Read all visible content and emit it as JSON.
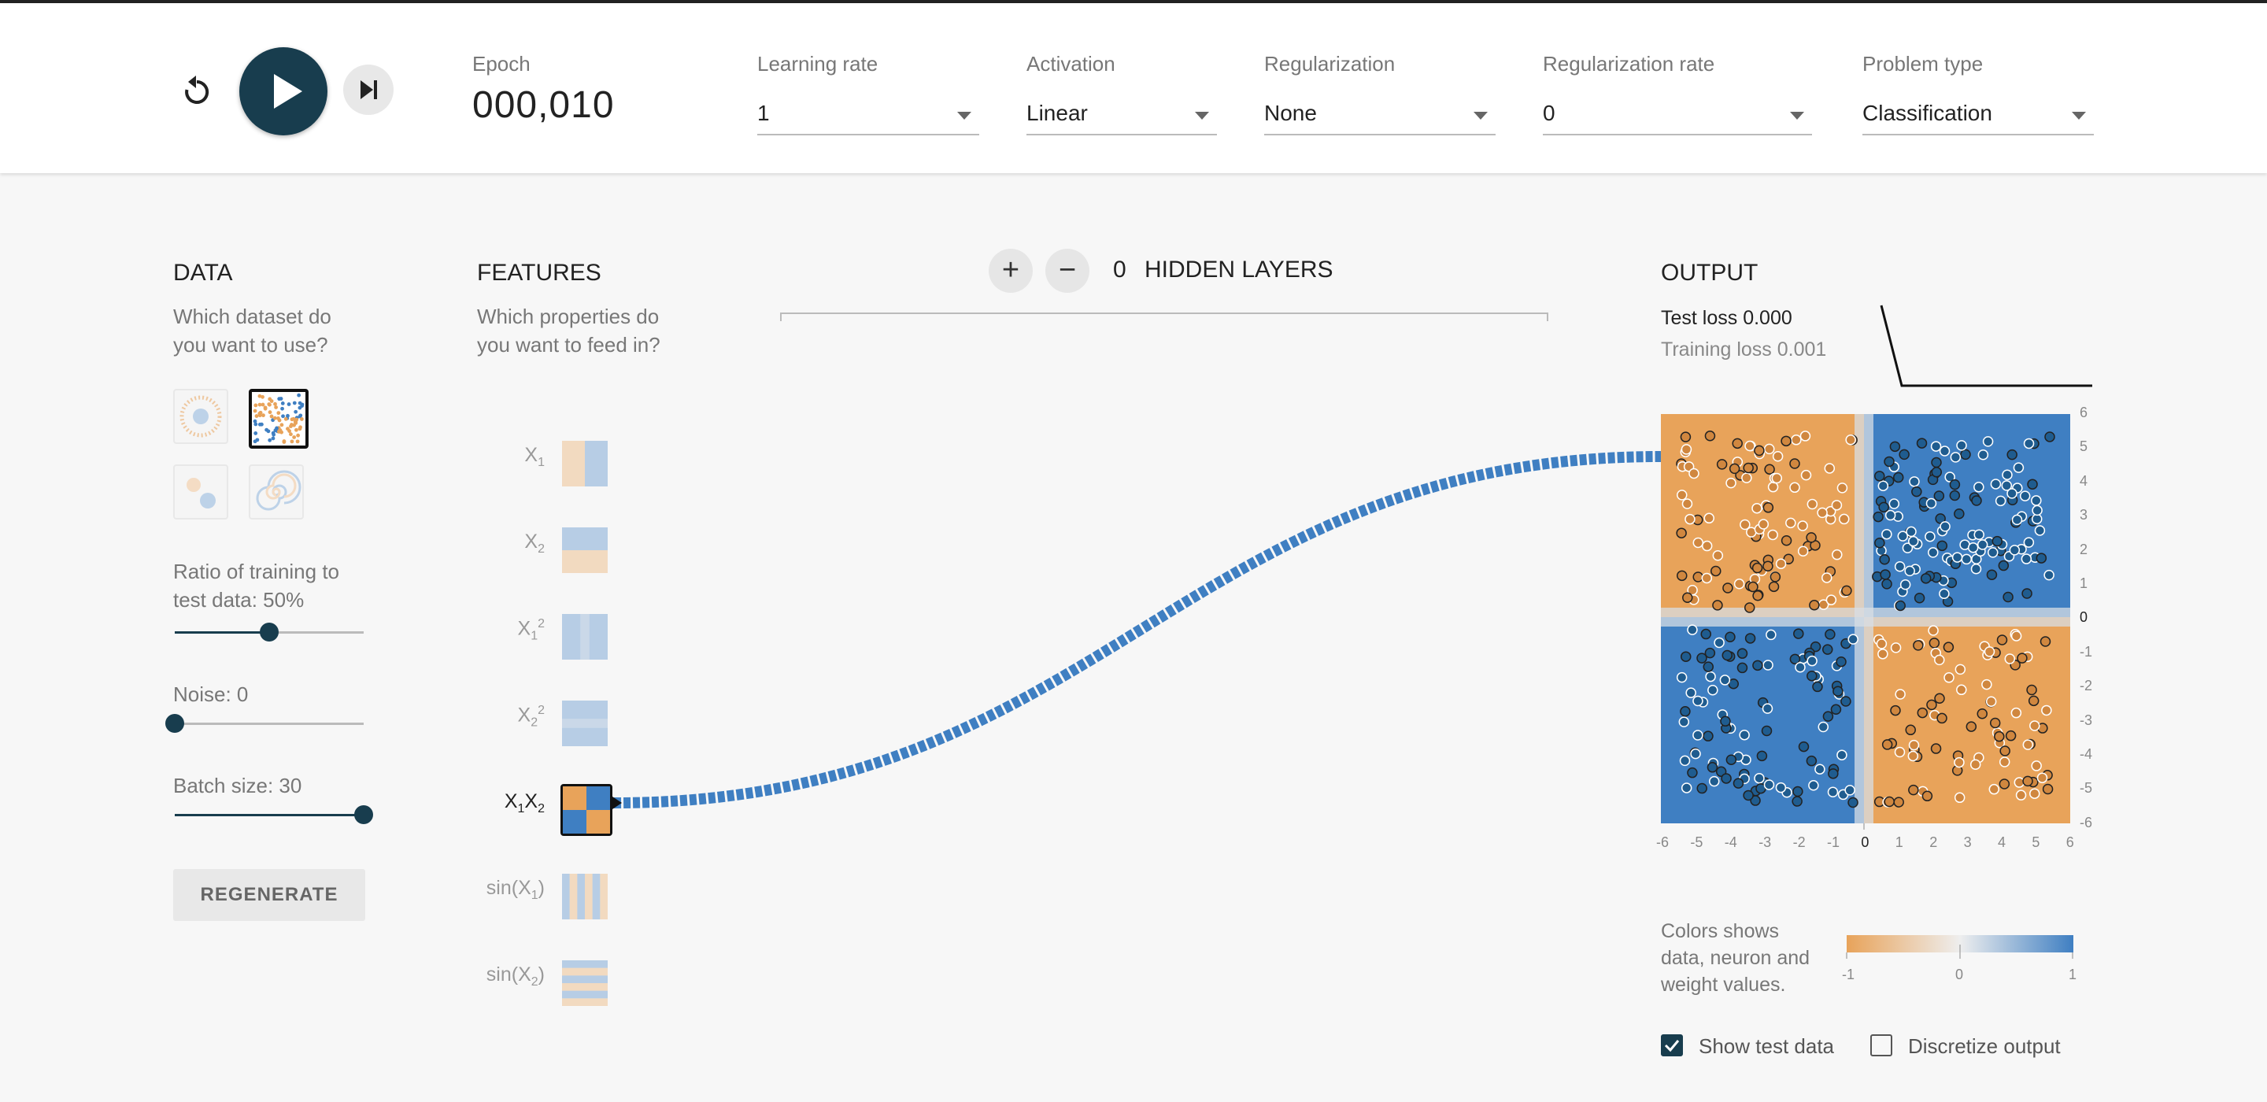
{
  "toolbar": {
    "epoch_label": "Epoch",
    "epoch_value": "000,010",
    "learning_rate": {
      "label": "Learning rate",
      "value": "1"
    },
    "activation": {
      "label": "Activation",
      "value": "Linear"
    },
    "regularization": {
      "label": "Regularization",
      "value": "None"
    },
    "regularization_rate": {
      "label": "Regularization rate",
      "value": "0"
    },
    "problem_type": {
      "label": "Problem type",
      "value": "Classification"
    }
  },
  "data_panel": {
    "title": "DATA",
    "description": [
      "Which dataset do",
      "you want to use?"
    ],
    "datasets": [
      "circle",
      "xor",
      "gaussian",
      "spiral"
    ],
    "selected_dataset": "xor",
    "ratio_label": [
      "Ratio of training to",
      "test data:  50%"
    ],
    "ratio_value": 50,
    "noise_label": "Noise:  0",
    "noise_value": 0,
    "batch_label": "Batch size:  30",
    "batch_value": 30,
    "regenerate_label": "REGENERATE"
  },
  "features_panel": {
    "title": "FEATURES",
    "description": [
      "Which properties do",
      "you want to feed in?"
    ],
    "features": [
      {
        "base": "X",
        "sub": "1",
        "sup": "",
        "pre": "",
        "post": "",
        "active": false
      },
      {
        "base": "X",
        "sub": "2",
        "sup": "",
        "pre": "",
        "post": "",
        "active": false
      },
      {
        "base": "X",
        "sub": "1",
        "sup": "2",
        "pre": "",
        "post": "",
        "active": false
      },
      {
        "base": "X",
        "sub": "2",
        "sup": "2",
        "pre": "",
        "post": "",
        "active": false
      },
      {
        "base": "X",
        "sub": "1",
        "sup": "",
        "pre": "",
        "post": "X",
        "post_sub": "2",
        "active": true
      },
      {
        "base": "X",
        "sub": "1",
        "sup": "",
        "pre": "sin(",
        "post": ")",
        "active": false
      },
      {
        "base": "X",
        "sub": "2",
        "sup": "",
        "pre": "sin(",
        "post": ")",
        "active": false
      }
    ]
  },
  "network": {
    "plus_label": "+",
    "minus_label": "−",
    "hidden_count": "0",
    "hidden_title": "HIDDEN LAYERS"
  },
  "output_panel": {
    "title": "OUTPUT",
    "test_loss": "Test loss 0.000",
    "training_loss": "Training loss 0.001",
    "y_ticks": [
      "6",
      "5",
      "4",
      "3",
      "2",
      "1",
      "0",
      "-1",
      "-2",
      "-3",
      "-4",
      "-5",
      "-6"
    ],
    "x_ticks": [
      "-6",
      "-5",
      "-4",
      "-3",
      "-2",
      "-1",
      "0",
      "1",
      "2",
      "3",
      "4",
      "5",
      "6"
    ],
    "legend_text": [
      "Colors shows",
      "data, neuron and",
      "weight values."
    ],
    "legend_ticks": [
      "-1",
      "0",
      "1"
    ],
    "show_test_data": {
      "label": "Show test data",
      "checked": true
    },
    "discretize_output": {
      "label": "Discretize output",
      "checked": false
    }
  },
  "colors": {
    "orange": "#e8a35a",
    "blue": "#3f7fc2",
    "dark": "#183d4e"
  }
}
